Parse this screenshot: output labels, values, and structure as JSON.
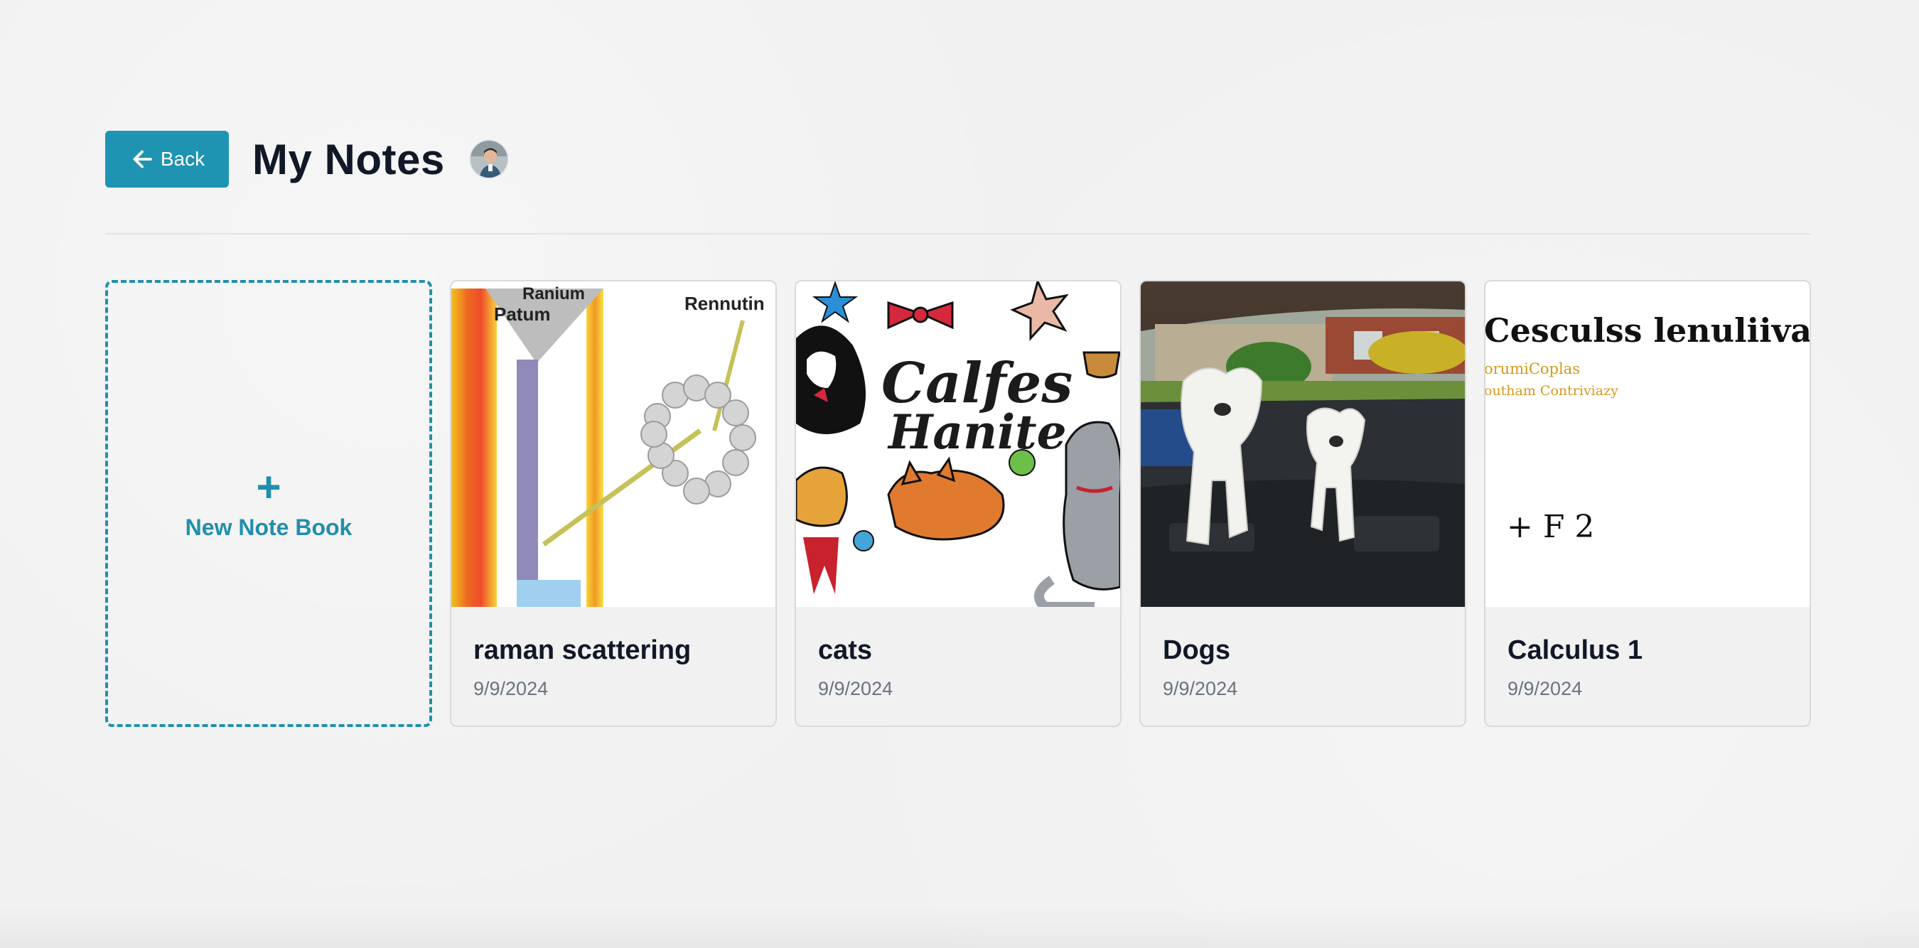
{
  "header": {
    "back_label": "Back",
    "title": "My Notes"
  },
  "new_notebook": {
    "plus": "+",
    "label": "New Note Book"
  },
  "notebooks": [
    {
      "title": "raman scattering",
      "date": "9/9/2024",
      "thumb_text": [
        "Ranium",
        "Patum",
        "Rennutin"
      ]
    },
    {
      "title": "cats",
      "date": "9/9/2024",
      "thumb_text": [
        "Calfes",
        "Hanite"
      ]
    },
    {
      "title": "Dogs",
      "date": "9/9/2024"
    },
    {
      "title": "Calculus 1",
      "date": "9/9/2024",
      "thumb_text": [
        "Cesculss lenuliivans",
        "orumiCoplas",
        "outham Contriviazy",
        "+   F 2"
      ]
    }
  ],
  "colors": {
    "accent": "#1f93b2",
    "title_text": "#111827",
    "muted_text": "#6b7280"
  }
}
